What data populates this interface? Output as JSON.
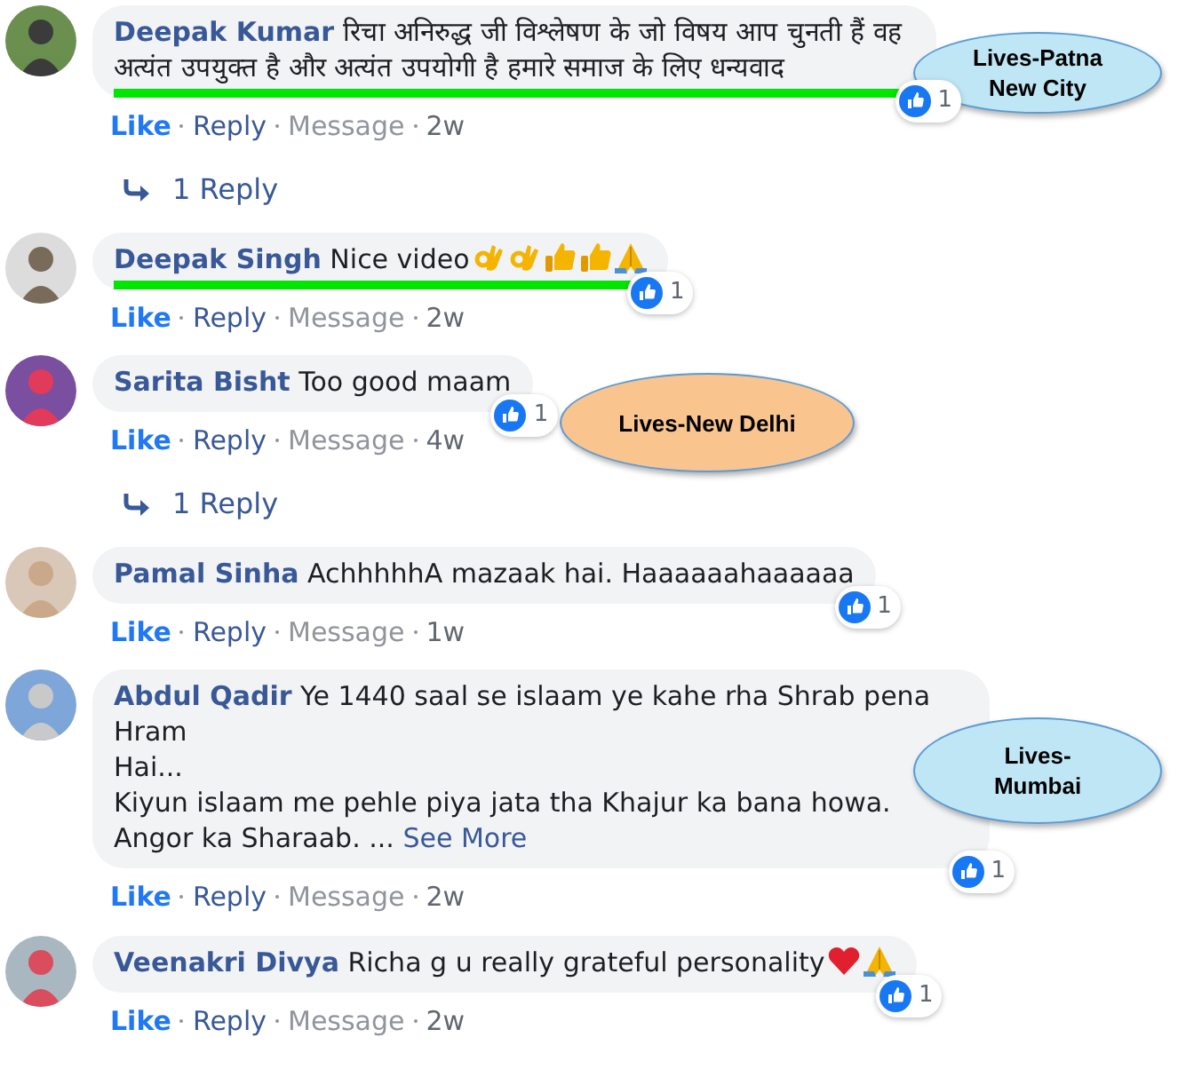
{
  "comments": [
    {
      "author": "Deepak Kumar",
      "text": "रिचा अनिरुद्ध जी विश्लेषण के जो विषय आप चुनती हैं वह अत्यंत उपयुक्त है और अत्यंत उपयोगी है हमारे समाज के लिए धन्यवाद",
      "highlighted": true,
      "reactions": "1",
      "like": "Like",
      "liked": true,
      "reply": "Reply",
      "message": "Message",
      "time": "2w",
      "replies": "1 Reply"
    },
    {
      "author": "Deepak Singh",
      "text": "Nice video",
      "emoji": [
        {
          "kind": "ok"
        },
        {
          "kind": "ok"
        },
        {
          "kind": "thumb"
        },
        {
          "kind": "thumb"
        },
        {
          "kind": "pray"
        }
      ],
      "highlighted": true,
      "reactions": "1",
      "like": "Like",
      "liked": true,
      "reply": "Reply",
      "message": "Message",
      "time": "2w"
    },
    {
      "author": "Sarita Bisht",
      "text": "Too good maam",
      "highlighted": false,
      "reactions": "1",
      "like": "Like",
      "liked": true,
      "reply": "Reply",
      "message": "Message",
      "time": "4w",
      "replies": "1 Reply"
    },
    {
      "author": "Pamal Sinha",
      "text": "AchhhhhA mazaak hai. Haaaaaahaaaaaa",
      "highlighted": false,
      "reactions": "1",
      "like": "Like",
      "liked": true,
      "reply": "Reply",
      "message": "Message",
      "time": "1w"
    },
    {
      "author": "Abdul Qadir",
      "text": "Ye 1440 saal se islaam ye kahe rha Shrab pena Hram\nHai...\nKiyun islaam me pehle piya jata tha Khajur ka bana howa. Angor ka Sharaab. ...",
      "see_more": "See More",
      "highlighted": false,
      "reactions": "1",
      "like": "Like",
      "liked": true,
      "reply": "Reply",
      "message": "Message",
      "time": "2w"
    },
    {
      "author": "Veenakri Divya",
      "text": "Richa g u really grateful personality",
      "emoji": [
        {
          "kind": "heart"
        },
        {
          "kind": "pray"
        }
      ],
      "highlighted": false,
      "reactions": "1",
      "like": "Like",
      "liked": true,
      "reply": "Reply",
      "message": "Message",
      "time": "2w"
    }
  ],
  "callouts": [
    {
      "lines": [
        "Lives-Patna",
        "New City"
      ],
      "color": "#bfe6f5"
    },
    {
      "lines": [
        "Lives-New Delhi"
      ],
      "color": "#f9c48e"
    },
    {
      "lines": [
        "Lives-",
        "Mumbai"
      ],
      "color": "#bfe6f5"
    }
  ]
}
